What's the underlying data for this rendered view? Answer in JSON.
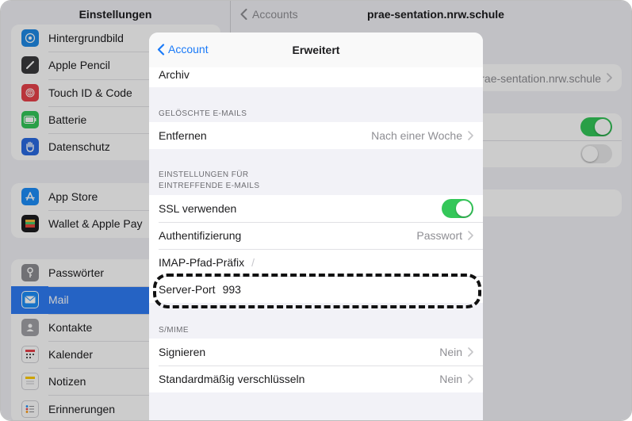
{
  "sidebar": {
    "title": "Einstellungen",
    "group1": [
      {
        "label": "Hintergrundbild",
        "icon": "wallpaper-icon",
        "color": "#1e8ae6"
      },
      {
        "label": "Apple Pencil",
        "icon": "pencil-icon",
        "color": "#3a3a3c"
      },
      {
        "label": "Touch ID & Code",
        "icon": "fingerprint-icon",
        "color": "#e8424a"
      },
      {
        "label": "Batterie",
        "icon": "battery-icon",
        "color": "#34c759"
      },
      {
        "label": "Datenschutz",
        "icon": "hand-icon",
        "color": "#2a6be3"
      }
    ],
    "group2": [
      {
        "label": "App Store",
        "icon": "app-store-icon",
        "color": "#1c8ef9"
      },
      {
        "label": "Wallet & Apple Pay",
        "icon": "wallet-icon",
        "color": "#1c1c1e"
      }
    ],
    "group3": [
      {
        "label": "Passwörter",
        "icon": "key-icon",
        "color": "#8e8e93"
      },
      {
        "label": "Mail",
        "icon": "mail-icon",
        "color": "#1c8ef9",
        "selected": true
      },
      {
        "label": "Kontakte",
        "icon": "contacts-icon",
        "color": "#a2a2a7"
      },
      {
        "label": "Kalender",
        "icon": "calendar-icon",
        "color": "#ffffff"
      },
      {
        "label": "Notizen",
        "icon": "notes-icon",
        "color": "#ffcc00"
      },
      {
        "label": "Erinnerungen",
        "icon": "reminders-icon",
        "color": "#ffffff"
      }
    ]
  },
  "detail": {
    "back_label": "Accounts",
    "title": "prae-sentation.nrw.schule",
    "account_value": "prae-sentation.nrw.schule"
  },
  "sheet": {
    "back_label": "Account",
    "title": "Erweitert",
    "top_row": "Archiv",
    "deleted_header": "GELÖSCHTE E-MAILS",
    "remove_label": "Entfernen",
    "remove_value": "Nach einer Woche",
    "incoming_header_line1": "EINSTELLUNGEN FÜR",
    "incoming_header_line2": "EINTREFFENDE E-MAILS",
    "ssl_label": "SSL verwenden",
    "ssl_on": true,
    "auth_label": "Authentifizierung",
    "auth_value": "Passwort",
    "imap_label": "IMAP-Pfad-Präfix",
    "imap_placeholder": "/",
    "port_label": "Server-Port",
    "port_value": "993",
    "smime_header": "S/MIME",
    "sign_label": "Signieren",
    "sign_value": "Nein",
    "encrypt_label": "Standardmäßig verschlüsseln",
    "encrypt_value": "Nein"
  },
  "colors": {
    "accent": "#1a7af8",
    "toggle_on": "#34c759",
    "selected": "#2f7cf6"
  }
}
